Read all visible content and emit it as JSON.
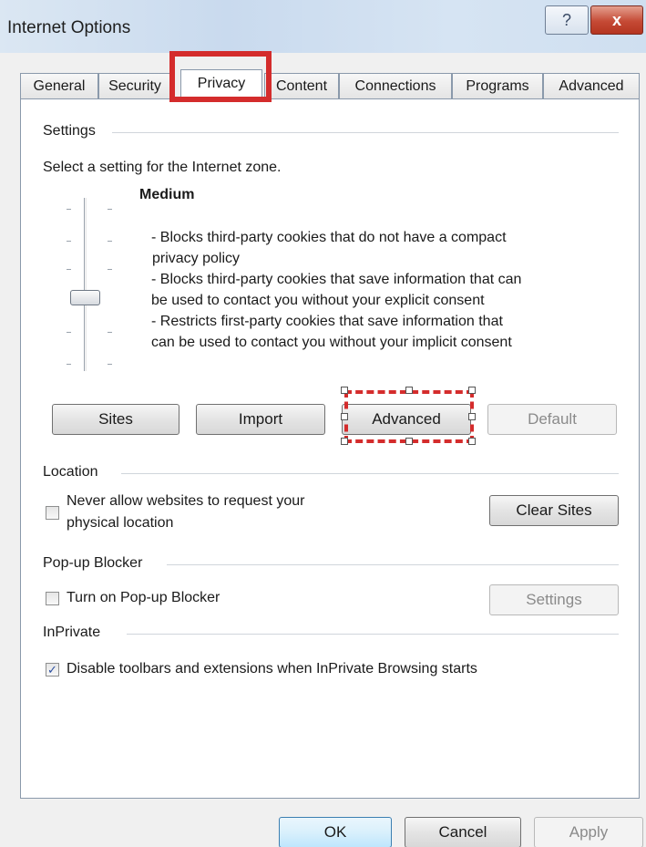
{
  "window": {
    "title": "Internet Options",
    "help_glyph": "?",
    "close_glyph": "x"
  },
  "tabs": [
    {
      "label": "General"
    },
    {
      "label": "Security"
    },
    {
      "label": "Privacy"
    },
    {
      "label": "Content"
    },
    {
      "label": "Connections"
    },
    {
      "label": "Programs"
    },
    {
      "label": "Advanced"
    }
  ],
  "active_tab": "Privacy",
  "settings": {
    "group_label": "Settings",
    "prompt": "Select a setting for the Internet zone.",
    "level": "Medium",
    "slider_level_fraction": 0.5,
    "description": [
      "- Blocks third-party cookies that do not have a compact",
      "privacy policy",
      "- Blocks third-party cookies that save information that can",
      "be used to contact you without your explicit consent",
      "- Restricts first-party cookies that save information that",
      "can be used to contact you without your implicit consent"
    ],
    "buttons": {
      "sites": "Sites",
      "import": "Import",
      "advanced": "Advanced",
      "default": "Default"
    }
  },
  "location": {
    "group_label": "Location",
    "never_allow_line1": "Never allow websites to request your",
    "never_allow_line2": "physical location",
    "never_allow_checked": false,
    "clear_sites": "Clear Sites"
  },
  "popup_blocker": {
    "group_label": "Pop-up Blocker",
    "turn_on_label": "Turn on Pop-up Blocker",
    "turn_on_checked": false,
    "settings_button": "Settings"
  },
  "inprivate": {
    "group_label": "InPrivate",
    "disable_toolbars_label": "Disable toolbars and extensions when InPrivate Browsing starts",
    "disable_toolbars_checked": true,
    "check_glyph": "✓"
  },
  "footer": {
    "ok": "OK",
    "cancel": "Cancel",
    "apply": "Apply"
  },
  "colors": {
    "highlight": "#d42c2c",
    "title_bar": "#c9daee",
    "close_button": "#c54a35"
  }
}
